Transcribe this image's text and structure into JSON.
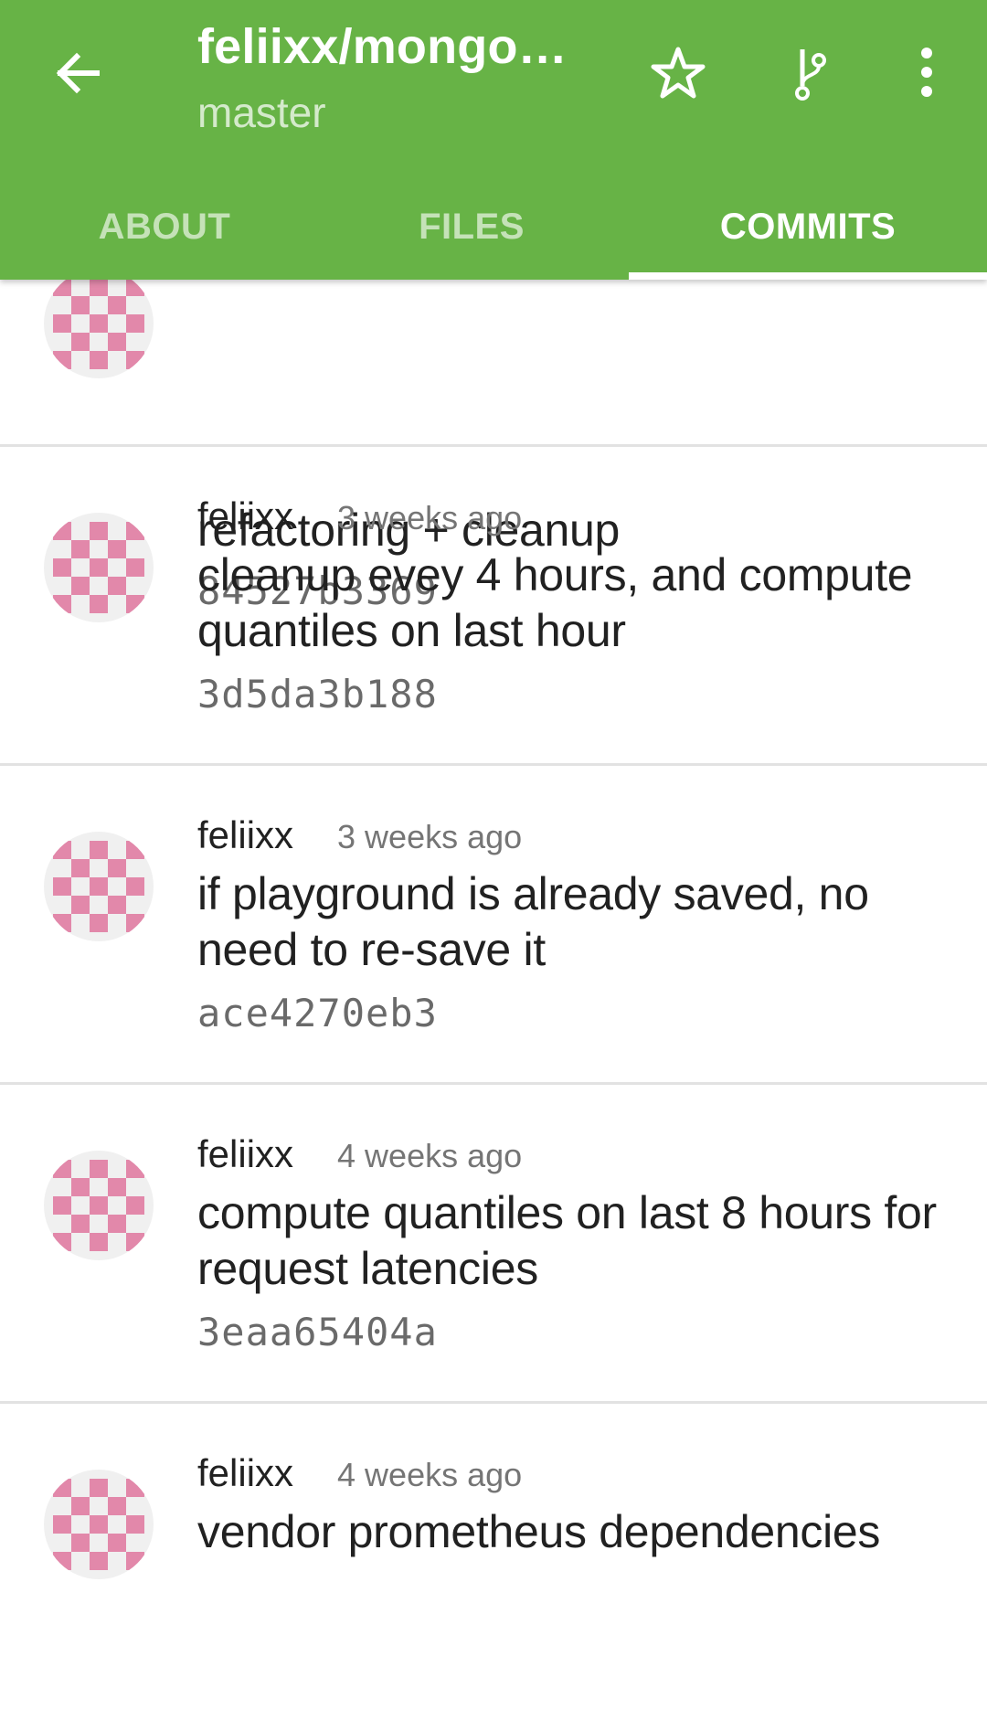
{
  "app_bar": {
    "title": "feliixx/mongo…",
    "subtitle": "master",
    "background": "#67b346"
  },
  "icons": {
    "back": "arrow-back-icon",
    "star": "star-outline-icon",
    "branch": "git-branch-icon",
    "overflow": "more-vert-icon"
  },
  "tabs": [
    {
      "label": "ABOUT",
      "active": false
    },
    {
      "label": "FILES",
      "active": false
    },
    {
      "label": "COMMITS",
      "active": true
    }
  ],
  "commits": [
    {
      "author": "",
      "date": "",
      "message": "refactoring + cleanup",
      "sha": "84527b3369"
    },
    {
      "author": "feliixx",
      "date": "3 weeks ago",
      "message": "cleanup evey 4 hours, and compute quantiles on last hour",
      "sha": "3d5da3b188"
    },
    {
      "author": "feliixx",
      "date": "3 weeks ago",
      "message": "if playground is already saved, no need to re-save it",
      "sha": "ace4270eb3"
    },
    {
      "author": "feliixx",
      "date": "4 weeks ago",
      "message": "compute quantiles on last 8 hours for request latencies",
      "sha": "3eaa65404a"
    },
    {
      "author": "feliixx",
      "date": "4 weeks ago",
      "message": "vendor prometheus dependencies",
      "sha": ""
    }
  ],
  "avatar_colors": {
    "fill": "#e288aa",
    "background": "#f0f0f0"
  }
}
